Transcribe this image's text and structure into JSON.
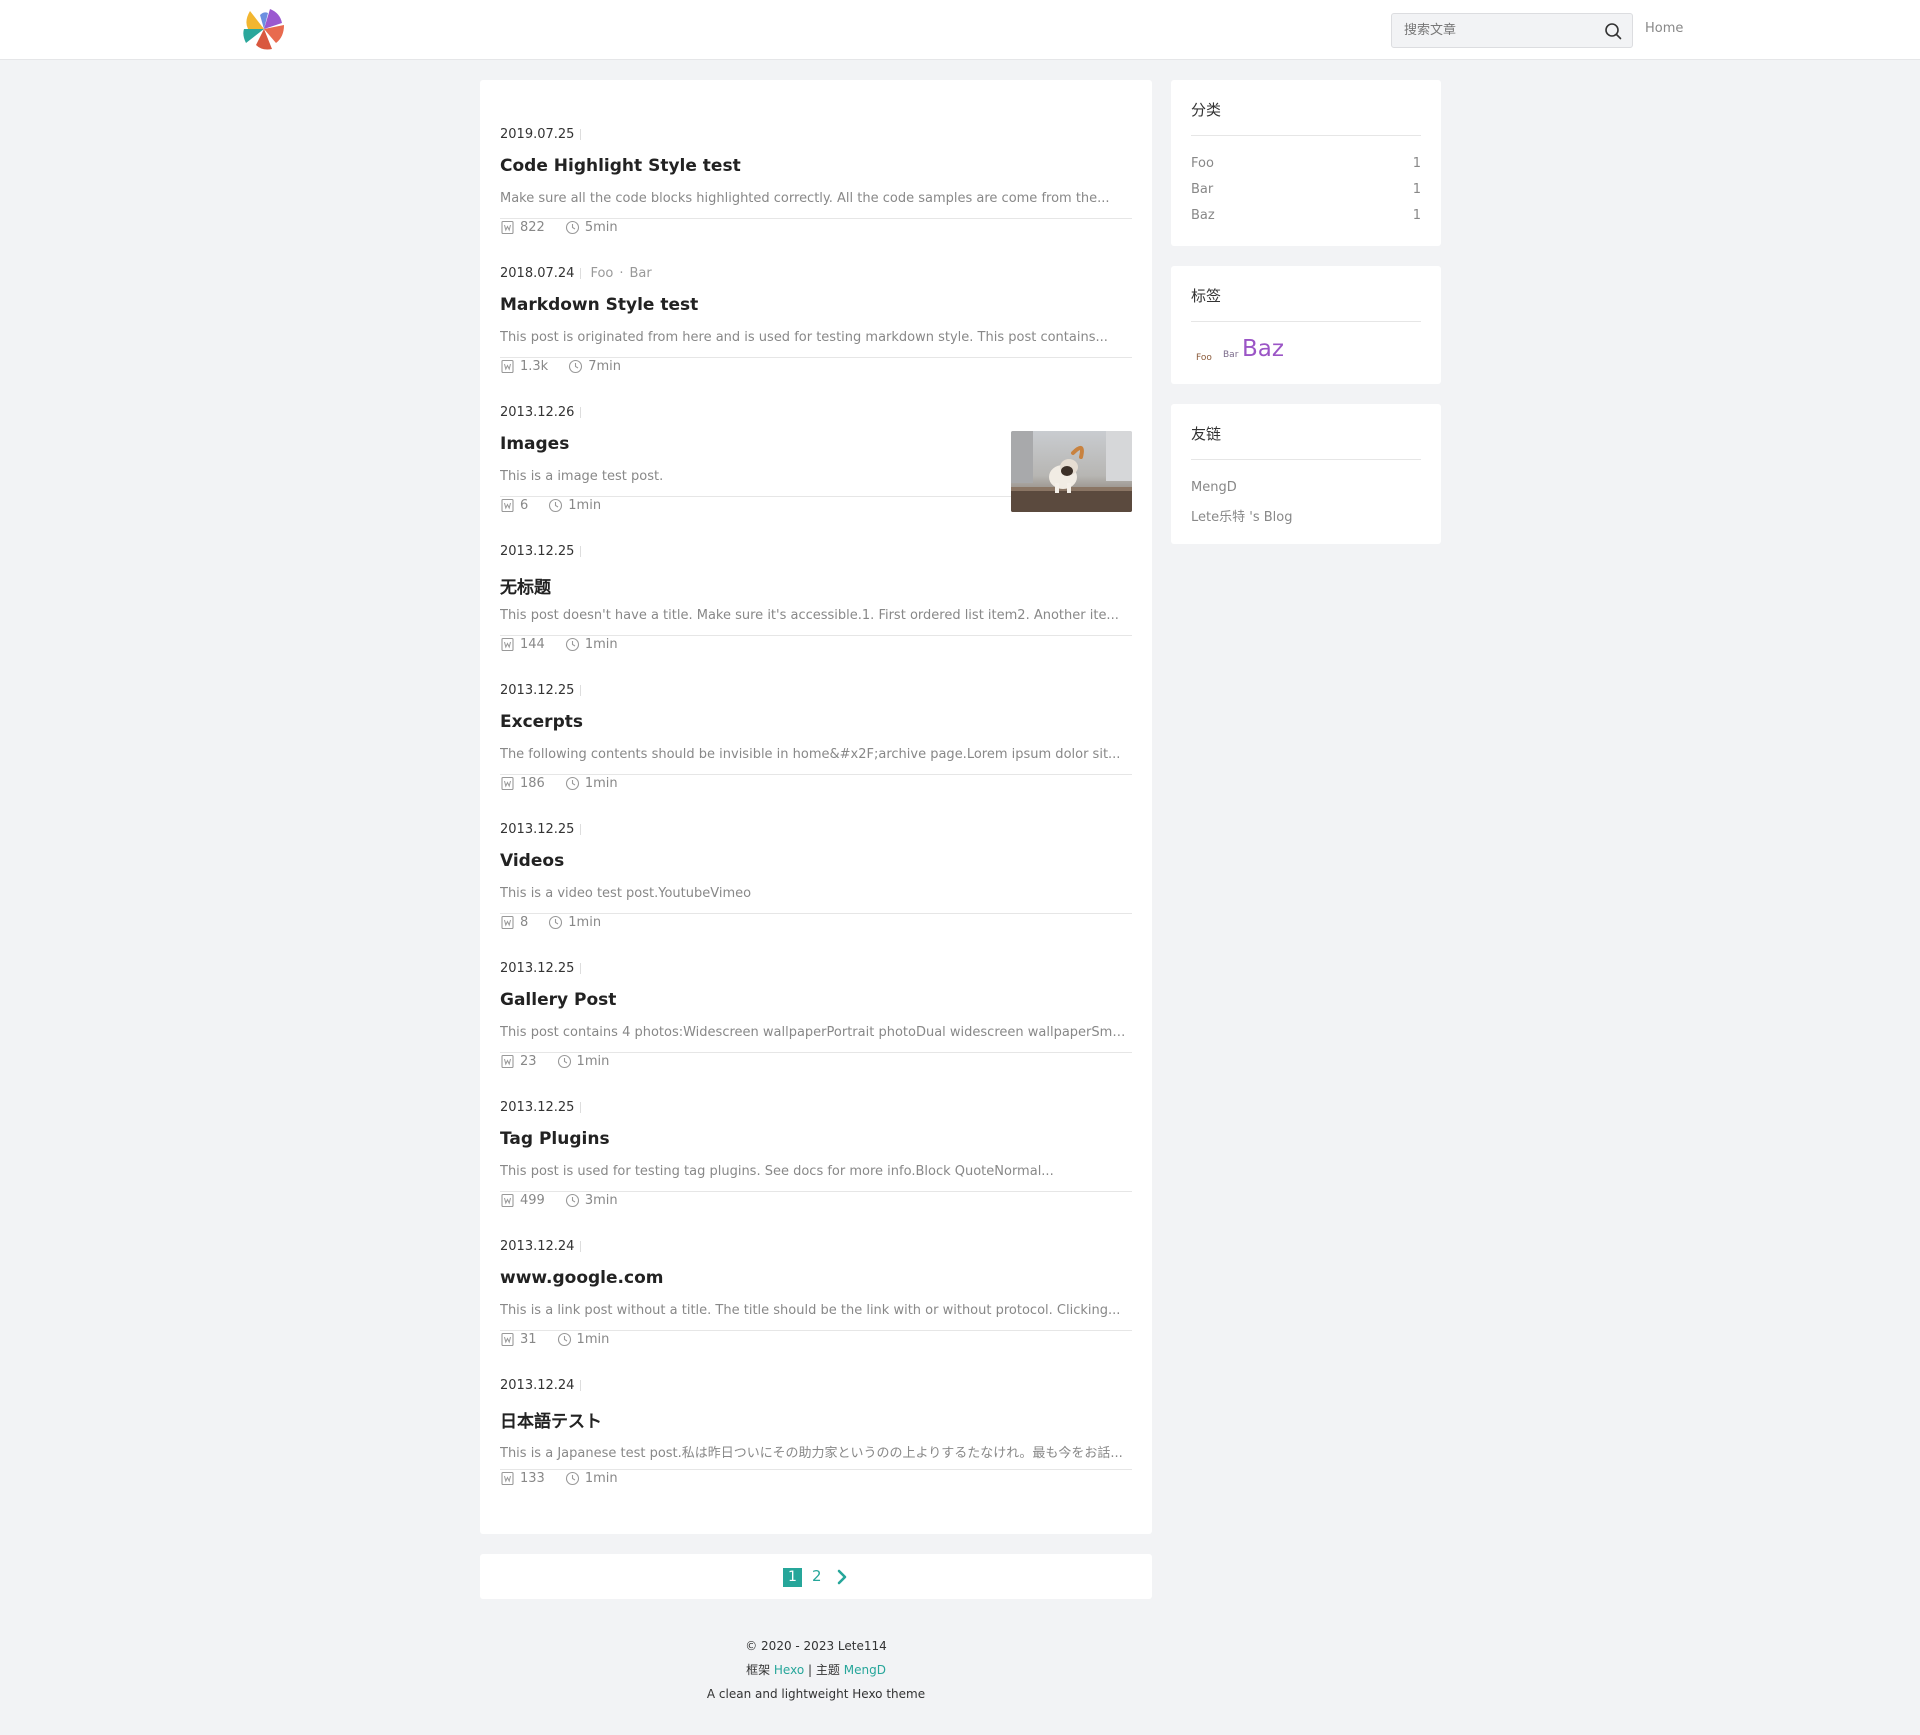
{
  "header": {
    "search_placeholder": "搜索文章",
    "nav_home": "Home",
    "accent": "#26a69a"
  },
  "posts": [
    {
      "date": "2019.07.25",
      "title": "Code Highlight Style test",
      "excerpt": "Make sure all the code blocks highlighted correctly. All the code samples are come from the...",
      "words": "822",
      "time": "5min"
    },
    {
      "date": "2018.07.24",
      "categories": [
        "Foo",
        "Bar"
      ],
      "title": "Markdown Style test",
      "excerpt": "This post is originated from here and is used for testing markdown style. This post contains...",
      "words": "1.3k",
      "time": "7min"
    },
    {
      "date": "2013.12.26",
      "title": "Images",
      "excerpt": "This is a image test post.",
      "words": "6",
      "time": "1min"
    },
    {
      "date": "2013.12.25",
      "title": "无标题",
      "excerpt": "This post doesn't have a title. Make sure it's accessible.1. First ordered list item2. Another ite...",
      "words": "144",
      "time": "1min"
    },
    {
      "date": "2013.12.25",
      "title": "Excerpts",
      "excerpt": "The following contents should be invisible in home&#x2F;archive page.Lorem ipsum dolor sit...",
      "words": "186",
      "time": "1min"
    },
    {
      "date": "2013.12.25",
      "title": "Videos",
      "excerpt": "This is a video test post.YoutubeVimeo",
      "words": "8",
      "time": "1min"
    },
    {
      "date": "2013.12.25",
      "title": "Gallery Post",
      "excerpt": "This post contains 4 photos:Widescreen wallpaperPortrait photoDual widescreen wallpaperSma...",
      "words": "23",
      "time": "1min"
    },
    {
      "date": "2013.12.25",
      "title": "Tag Plugins",
      "excerpt": "This post is used for testing tag plugins. See docs for more info.Block QuoteNormal...",
      "words": "499",
      "time": "3min"
    },
    {
      "date": "2013.12.24",
      "title": "www.google.com",
      "excerpt": "This is a link post without a title. The title should be the link with or without protocol. Clicking...",
      "words": "31",
      "time": "1min"
    },
    {
      "date": "2013.12.24",
      "title": "日本語テスト",
      "excerpt": "This is a Japanese test post.私は昨日ついにその助力家というのの上よりするたなけれ。最も今をお話...",
      "words": "133",
      "time": "1min"
    }
  ],
  "sidebar": {
    "categories": {
      "title": "分类",
      "items": [
        {
          "name": "Foo",
          "count": "1"
        },
        {
          "name": "Bar",
          "count": "1"
        },
        {
          "name": "Baz",
          "count": "1"
        }
      ]
    },
    "tags": {
      "title": "标签",
      "items": [
        "Foo",
        "Bar",
        "Baz"
      ]
    },
    "links": {
      "title": "友链",
      "items": [
        "MengD",
        "Lete乐特 's Blog"
      ]
    }
  },
  "pagination": {
    "current": "1",
    "next_page": "2"
  },
  "footer": {
    "copyright": "© 2020 - 2023 Lete114",
    "framework_label": "框架",
    "framework_name": "Hexo",
    "divider": "|",
    "theme_label": "主题",
    "theme_name": "MengD",
    "tagline": "A clean and lightweight Hexo theme"
  }
}
